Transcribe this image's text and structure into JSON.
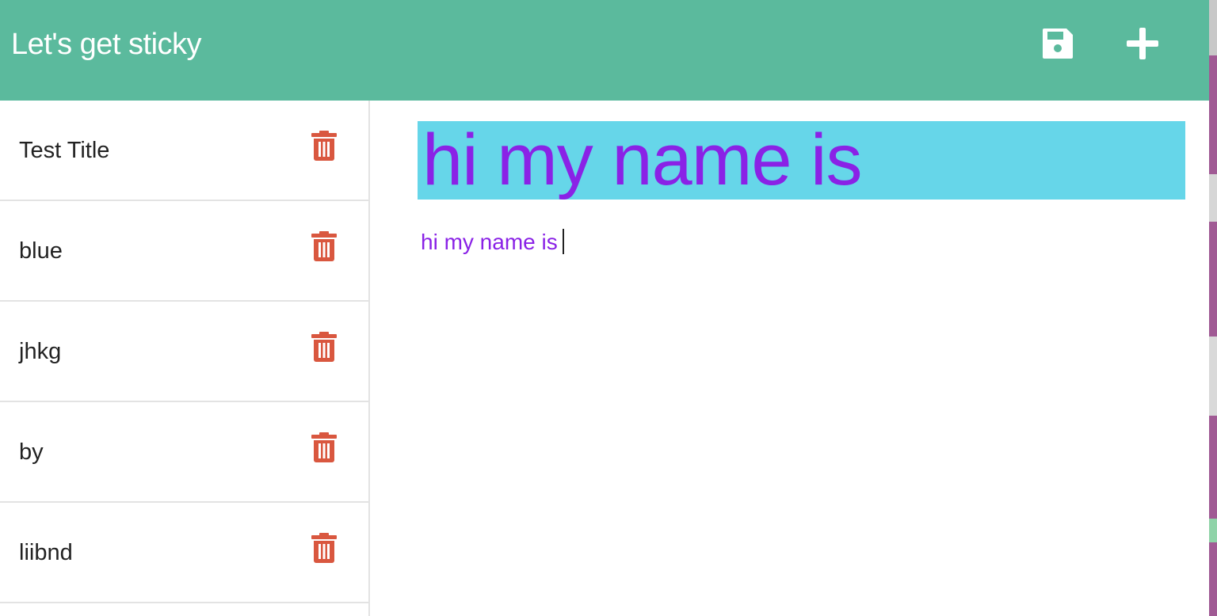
{
  "header": {
    "title": "Let's get sticky",
    "save_icon": "floppy-disk-icon",
    "add_icon": "plus-icon",
    "background_color": "#5bba9d"
  },
  "notes": [
    {
      "title": "Test Title",
      "delete_icon": "trash-icon"
    },
    {
      "title": "blue",
      "delete_icon": "trash-icon"
    },
    {
      "title": "jhkg",
      "delete_icon": "trash-icon"
    },
    {
      "title": "by",
      "delete_icon": "trash-icon"
    },
    {
      "title": "liibnd",
      "delete_icon": "trash-icon"
    }
  ],
  "editor": {
    "title_value": "hi my name is",
    "body_value": "hi my name is",
    "title_background": "#66d6e9",
    "text_color": "#8a22e6"
  },
  "colors": {
    "delete_icon": "#d9573f"
  }
}
